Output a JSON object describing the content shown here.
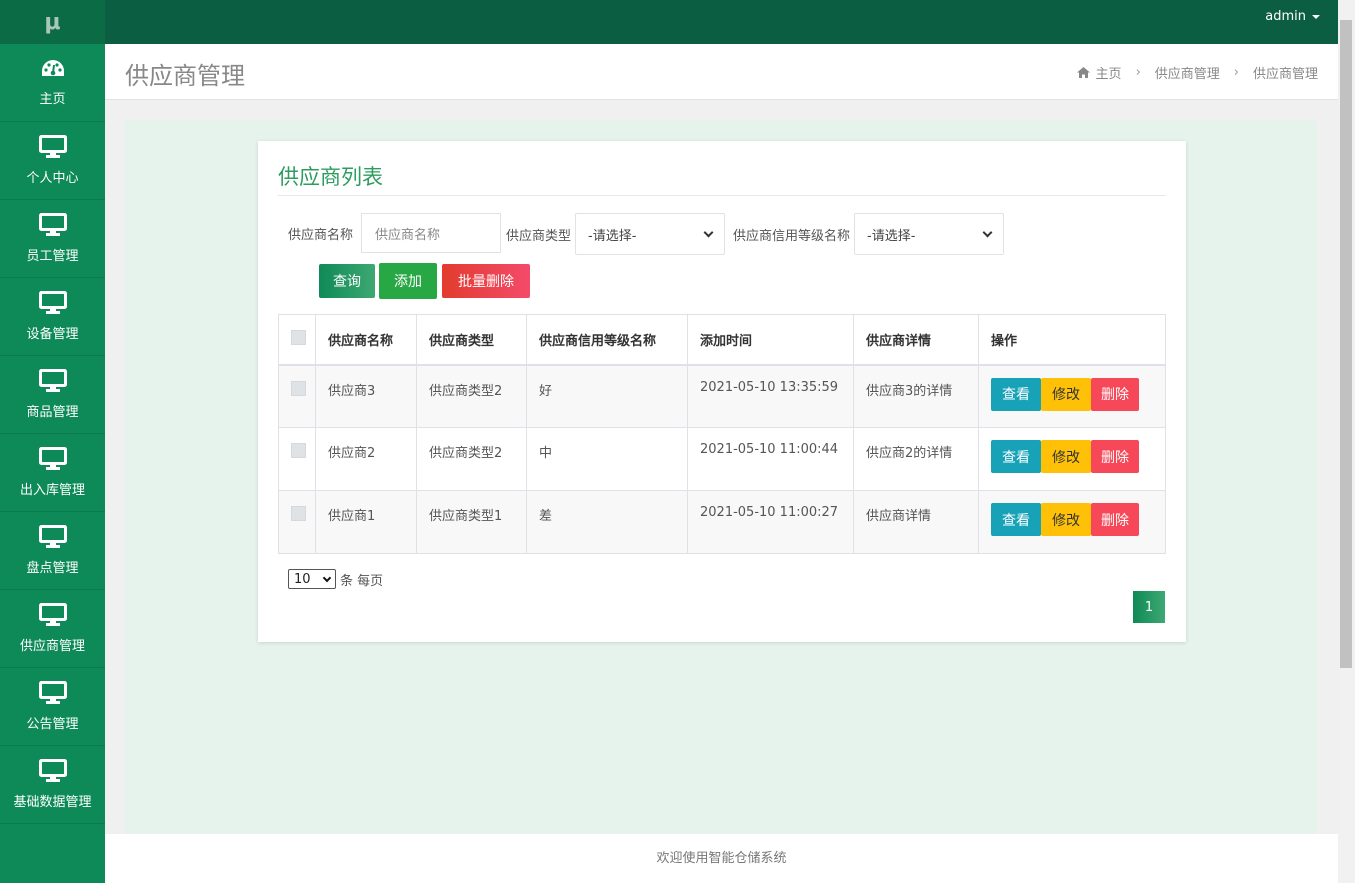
{
  "sidebar": {
    "logo": "μ",
    "items": [
      {
        "label": "主页",
        "icon": "dashboard-icon"
      },
      {
        "label": "个人中心",
        "icon": "monitor-icon"
      },
      {
        "label": "员工管理",
        "icon": "monitor-icon"
      },
      {
        "label": "设备管理",
        "icon": "monitor-icon"
      },
      {
        "label": "商品管理",
        "icon": "monitor-icon"
      },
      {
        "label": "出入库管理",
        "icon": "monitor-icon"
      },
      {
        "label": "盘点管理",
        "icon": "monitor-icon"
      },
      {
        "label": "供应商管理",
        "icon": "monitor-icon"
      },
      {
        "label": "公告管理",
        "icon": "monitor-icon"
      },
      {
        "label": "基础数据管理",
        "icon": "monitor-icon"
      }
    ]
  },
  "topbar": {
    "user": "admin"
  },
  "header": {
    "title": "供应商管理",
    "breadcrumb": [
      "主页",
      "供应商管理",
      "供应商管理"
    ]
  },
  "card": {
    "title": "供应商列表",
    "filters": {
      "name_label": "供应商名称",
      "name_placeholder": "供应商名称",
      "type_label": "供应商类型",
      "type_value": "-请选择-",
      "credit_label": "供应商信用等级名称",
      "credit_value": "-请选择-"
    },
    "buttons": {
      "query": "查询",
      "add": "添加",
      "batch_delete": "批量删除"
    },
    "table": {
      "headers": [
        "供应商名称",
        "供应商类型",
        "供应商信用等级名称",
        "添加时间",
        "供应商详情",
        "操作"
      ],
      "rows": [
        {
          "name": "供应商3",
          "type": "供应商类型2",
          "credit": "好",
          "time": "2021-05-10 13:35:59",
          "detail": "供应商3的详情"
        },
        {
          "name": "供应商2",
          "type": "供应商类型2",
          "credit": "中",
          "time": "2021-05-10 11:00:44",
          "detail": "供应商2的详情"
        },
        {
          "name": "供应商1",
          "type": "供应商类型1",
          "credit": "差",
          "time": "2021-05-10 11:00:27",
          "detail": "供应商详情"
        }
      ],
      "actions": {
        "view": "查看",
        "edit": "修改",
        "delete": "删除"
      }
    },
    "pager": {
      "page_size": "10",
      "per_page_text": "条 每页",
      "current_page": "1"
    }
  },
  "footer": {
    "text": "欢迎使用智能仓储系统"
  },
  "colors": {
    "sidebar": "#0d8a57",
    "topbar": "#0b5e41",
    "accent": "#2e9c5f"
  }
}
